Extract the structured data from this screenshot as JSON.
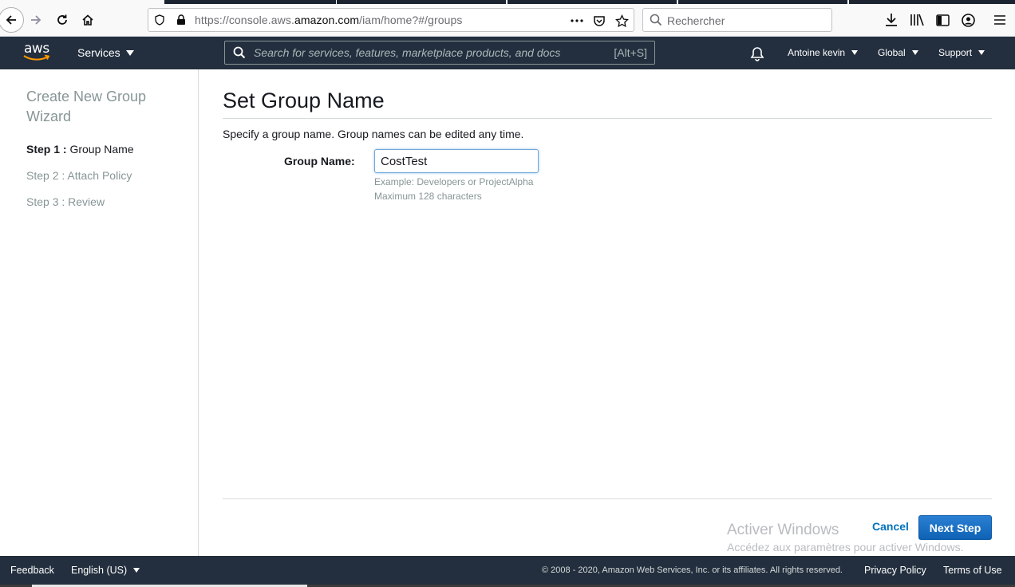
{
  "browser": {
    "url_prefix": "https://console.aws.",
    "url_domain": "amazon.com",
    "url_suffix": "/iam/home?#/groups",
    "search_placeholder": "Rechercher"
  },
  "aws_header": {
    "logo": "aws",
    "services_label": "Services",
    "search_placeholder": "Search for services, features, marketplace products, and docs",
    "search_shortcut": "[Alt+S]",
    "account_label": "Antoine kevin",
    "region_label": "Global",
    "support_label": "Support"
  },
  "wizard": {
    "title": "Create New Group Wizard",
    "steps": [
      {
        "num": "Step 1 :",
        "label": "Group Name"
      },
      {
        "num": "Step 2 :",
        "label": "Attach Policy"
      },
      {
        "num": "Step 3 :",
        "label": "Review"
      }
    ]
  },
  "main": {
    "title": "Set Group Name",
    "description": "Specify a group name. Group names can be edited any time.",
    "field_label": "Group Name:",
    "field_value": "CostTest",
    "hint_1": "Example: Developers or ProjectAlpha",
    "hint_2": "Maximum 128 characters",
    "cancel_label": "Cancel",
    "next_label": "Next Step"
  },
  "watermark": {
    "line1": "Activer Windows",
    "line2": "Accédez aux paramètres pour activer Windows."
  },
  "footer": {
    "feedback": "Feedback",
    "language": "English (US)",
    "copyright": "© 2008 - 2020, Amazon Web Services, Inc. or its affiliates. All rights reserved.",
    "privacy": "Privacy Policy",
    "terms": "Terms of Use"
  },
  "colors": {
    "aws_nav": "#232f3e",
    "primary_button": "#1a6fc4",
    "link": "#0073bb",
    "muted_text": "#879596"
  }
}
